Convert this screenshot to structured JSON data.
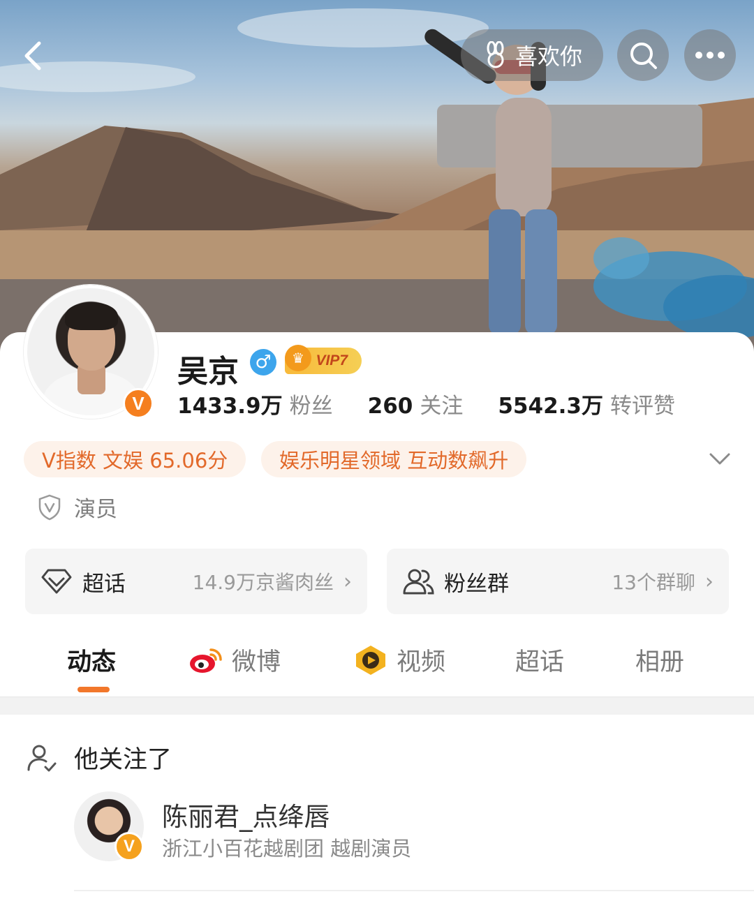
{
  "header": {
    "like_label": "喜欢你"
  },
  "profile": {
    "name": "吴京",
    "vip_label": "VIP7",
    "gender_symbol": "♂",
    "stats": [
      {
        "num": "1433.9万",
        "label": "粉丝"
      },
      {
        "num": "260",
        "label": "关注"
      },
      {
        "num": "5542.3万",
        "label": "转评赞"
      }
    ],
    "chips": [
      "V指数 文娱 65.06分",
      "娱乐明星领域 互动数飙升"
    ],
    "role": "演员"
  },
  "entries": {
    "super_topic": {
      "label": "超话",
      "sub": "14.9万京酱肉丝"
    },
    "fan_group": {
      "label": "粉丝群",
      "sub": "13个群聊"
    }
  },
  "tabs": [
    "动态",
    "微博",
    "视频",
    "超话",
    "相册"
  ],
  "feed": {
    "header": "他关注了",
    "user": {
      "name": "陈丽君_点绛唇",
      "desc": "浙江小百花越剧团 越剧演员"
    }
  },
  "colors": {
    "accent": "#f2772b",
    "chip_bg": "#fdf2ea",
    "chip_text": "#e2692a",
    "verified_badge": "#f57f1f",
    "gender": "#3da5ec"
  }
}
